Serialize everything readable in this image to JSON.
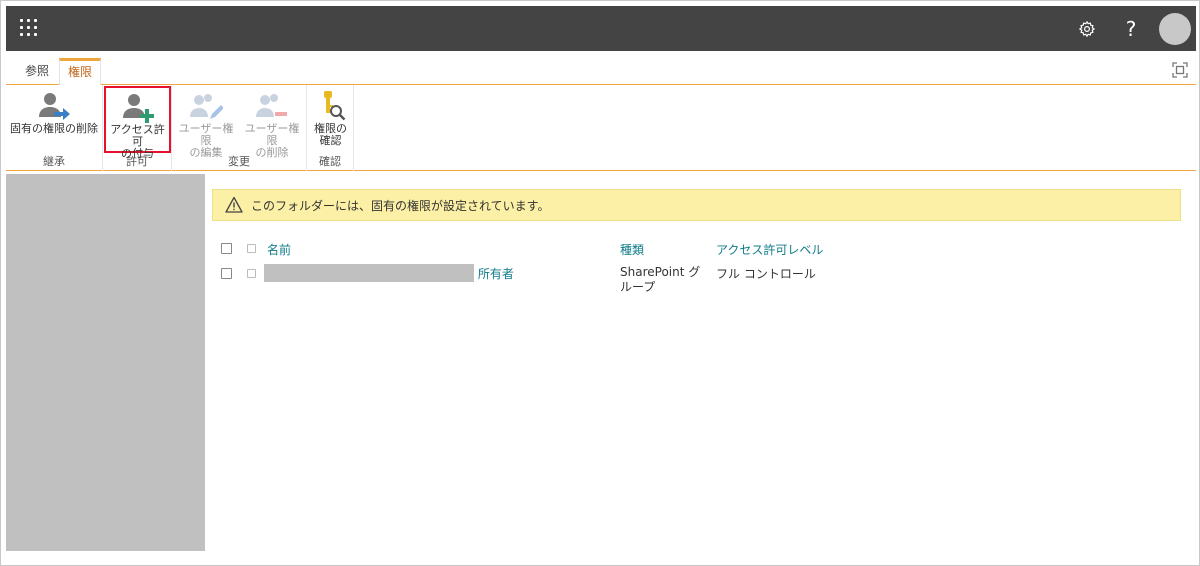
{
  "suitebar": {
    "icons": {
      "waffle": "waffle-icon",
      "settings": "gear-icon",
      "help": "?"
    }
  },
  "tabs": [
    {
      "label": "参照"
    },
    {
      "label": "権限"
    }
  ],
  "ribbon": {
    "groups": [
      {
        "label": "継承",
        "buttons": [
          {
            "label": "固有の権限の削除",
            "icon": "user-arrow-icon"
          }
        ]
      },
      {
        "label": "許可",
        "buttons": [
          {
            "label": "アクセス許可\nの付与",
            "icon": "user-add-icon"
          }
        ]
      },
      {
        "label": "変更",
        "buttons": [
          {
            "label": "ユーザー権限\nの編集",
            "icon": "users-edit-icon"
          },
          {
            "label": "ユーザー権限\nの削除",
            "icon": "users-remove-icon"
          }
        ]
      },
      {
        "label": "確認",
        "buttons": [
          {
            "label": "権限の\n確認",
            "icon": "key-search-icon"
          }
        ]
      }
    ]
  },
  "warning": {
    "text": "このフォルダーには、固有の権限が設定されています。"
  },
  "table": {
    "headers": {
      "name": "名前",
      "type": "種類",
      "level": "アクセス許可レベル"
    },
    "rows": [
      {
        "name_suffix": " 所有者",
        "type": "SharePoint グ\nループ",
        "level": "フル コントロール"
      }
    ]
  },
  "colors": {
    "accent": "#f0a640",
    "link": "#0f7c88",
    "suitebar": "#444444",
    "warning_bg": "#fcf0a6"
  }
}
